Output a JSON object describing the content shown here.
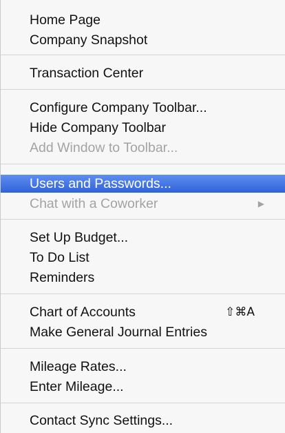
{
  "menu": {
    "home_page": "Home Page",
    "company_snapshot": "Company Snapshot",
    "transaction_center": "Transaction Center",
    "configure_company_toolbar": "Configure Company Toolbar...",
    "hide_company_toolbar": "Hide Company Toolbar",
    "add_window_to_toolbar": "Add Window to Toolbar...",
    "users_and_passwords": "Users and Passwords...",
    "chat_with_coworker": "Chat with a Coworker",
    "set_up_budget": "Set Up Budget...",
    "to_do_list": "To Do List",
    "reminders": "Reminders",
    "chart_of_accounts": "Chart of Accounts",
    "chart_of_accounts_shortcut": "⇧⌘A",
    "make_general_journal_entries": "Make General Journal Entries",
    "mileage_rates": "Mileage Rates...",
    "enter_mileage": "Enter Mileage...",
    "contact_sync_settings": "Contact Sync Settings..."
  },
  "icons": {
    "submenu_arrow": "▶"
  },
  "colors": {
    "highlight": "#3a6ee0",
    "disabled_text": "#a3a3a3"
  }
}
